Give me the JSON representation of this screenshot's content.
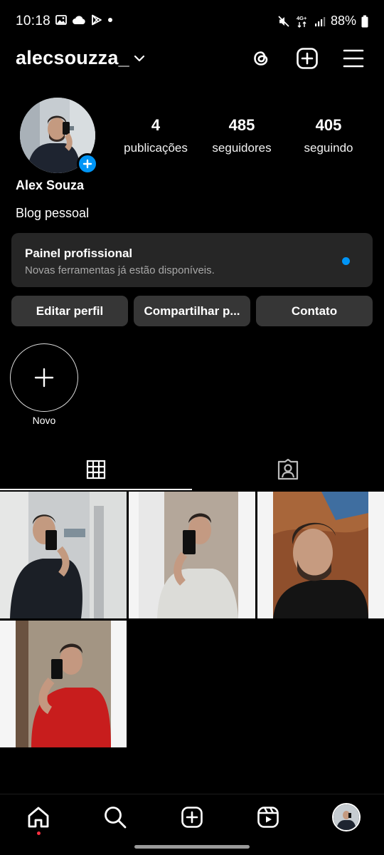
{
  "status_bar": {
    "time": "10:18",
    "battery": "88%",
    "network": "4G+"
  },
  "header": {
    "username": "alecsouzza_"
  },
  "profile": {
    "stats": [
      {
        "value": "4",
        "label": "publicações"
      },
      {
        "value": "485",
        "label": "seguidores"
      },
      {
        "value": "405",
        "label": "seguindo"
      }
    ],
    "name": "Alex Souza",
    "bio": "Blog pessoal"
  },
  "dashboard": {
    "title": "Painel profissional",
    "subtitle": "Novas ferramentas já estão disponíveis."
  },
  "actions": {
    "edit": "Editar perfil",
    "share": "Compartilhar p...",
    "contact": "Contato"
  },
  "highlights": {
    "new_label": "Novo"
  },
  "colors": {
    "accent": "#0095f6",
    "background": "#000000",
    "button": "#363636",
    "card": "#262626"
  }
}
